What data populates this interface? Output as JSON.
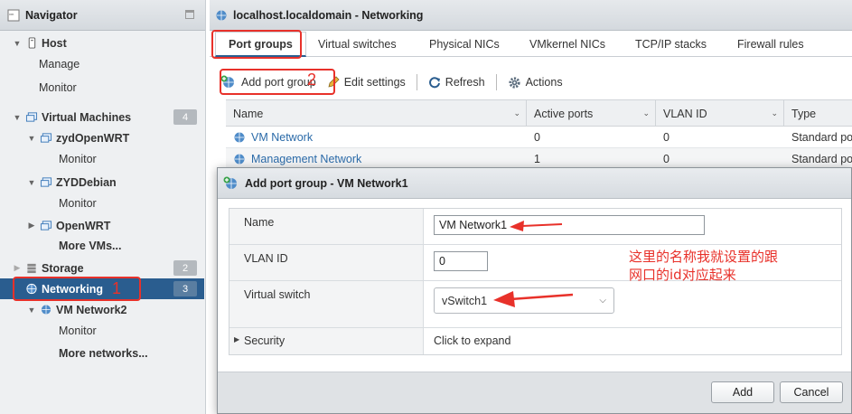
{
  "colors": {
    "accent": "#2a5d8f",
    "link": "#2a6aa8",
    "annotation": "#e8312a"
  },
  "navigator": {
    "title": "Navigator",
    "items": [
      {
        "label": "Host",
        "icon": "host-icon",
        "expanded": true
      },
      {
        "label": "Manage"
      },
      {
        "label": "Monitor"
      },
      {
        "label": "Virtual Machines",
        "icon": "vm-icon",
        "count": "4",
        "expanded": true
      },
      {
        "label": "zydOpenWRT",
        "icon": "vm-icon",
        "expanded": true
      },
      {
        "label": "Monitor"
      },
      {
        "label": "ZYDDebian",
        "icon": "vm-icon",
        "expanded": true
      },
      {
        "label": "Monitor"
      },
      {
        "label": "OpenWRT",
        "icon": "vm-icon",
        "expanded": false
      },
      {
        "label": "More VMs..."
      },
      {
        "label": "Storage",
        "icon": "storage-icon",
        "count": "2"
      },
      {
        "label": "Networking",
        "icon": "network-icon",
        "count": "3",
        "selected": true
      },
      {
        "label": "VM Network2",
        "icon": "network-icon",
        "expanded": true
      },
      {
        "label": "Monitor"
      },
      {
        "label": "More networks..."
      }
    ]
  },
  "main": {
    "title": "localhost.localdomain - Networking",
    "tabs": [
      "Port groups",
      "Virtual switches",
      "Physical NICs",
      "VMkernel NICs",
      "TCP/IP stacks",
      "Firewall rules"
    ],
    "active_tab": "Port groups",
    "toolbar": {
      "add": "Add port group",
      "edit": "Edit settings",
      "refresh": "Refresh",
      "actions": "Actions"
    },
    "table": {
      "columns": [
        "Name",
        "Active ports",
        "VLAN ID",
        "Type"
      ],
      "rows": [
        {
          "name": "VM Network",
          "active_ports": "0",
          "vlan_id": "0",
          "type": "Standard port group"
        },
        {
          "name": "Management Network",
          "active_ports": "1",
          "vlan_id": "0",
          "type": "Standard port group"
        }
      ]
    }
  },
  "dialog": {
    "title": "Add port group - VM Network1",
    "fields": {
      "name_label": "Name",
      "name_value": "VM Network1",
      "vlan_label": "VLAN ID",
      "vlan_value": "0",
      "vswitch_label": "Virtual switch",
      "vswitch_value": "vSwitch1",
      "security_label": "Security",
      "security_value": "Click to expand"
    },
    "buttons": {
      "add": "Add",
      "cancel": "Cancel"
    }
  },
  "annotations": {
    "num1": "1",
    "num2": "2",
    "note_line1": "这里的名称我就设置的跟",
    "note_line2": "网口的id对应起来"
  }
}
